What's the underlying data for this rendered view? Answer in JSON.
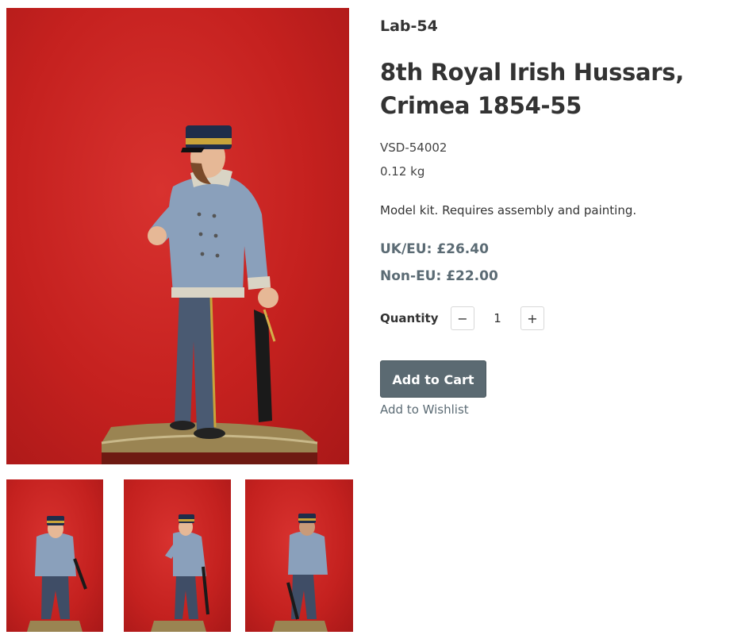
{
  "product": {
    "brand": "Lab-54",
    "title": "8th Royal Irish Hussars, Crimea 1854-55",
    "sku": "VSD-54002",
    "weight": "0.12 kg",
    "description": "Model kit. Requires assembly and painting.",
    "price_uk_eu": "UK/EU: £26.40",
    "price_non_eu": "Non-EU: £22.00"
  },
  "quantity": {
    "label": "Quantity",
    "value": "1",
    "minus_label": "−",
    "plus_label": "+"
  },
  "actions": {
    "add_to_cart": "Add to Cart",
    "add_to_wishlist": "Add to Wishlist"
  },
  "gallery": {
    "main_image": "figure-front-side-view",
    "thumbnails": [
      "figure-front-view",
      "figure-side-view",
      "figure-back-view"
    ]
  },
  "colors": {
    "background_red": "#c5211f",
    "button": "#5b6a72",
    "price_text": "#5b6b74"
  }
}
